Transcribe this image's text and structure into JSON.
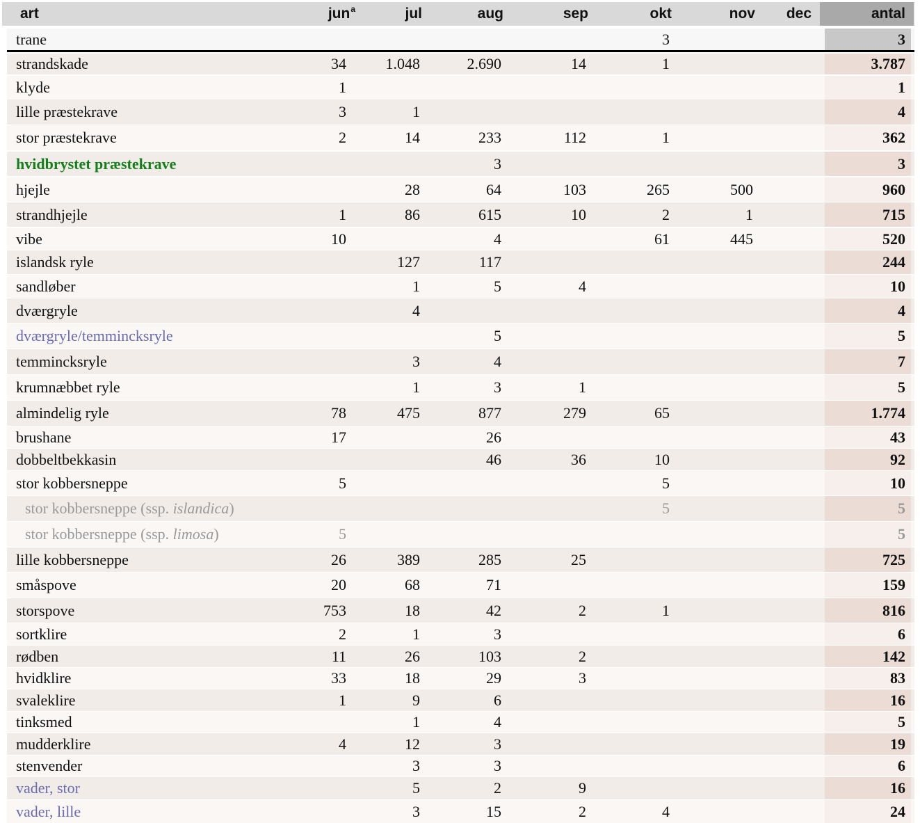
{
  "columns": [
    {
      "label": "art"
    },
    {
      "label": "jun",
      "sup": "a"
    },
    {
      "label": "jul"
    },
    {
      "label": "aug"
    },
    {
      "label": "sep"
    },
    {
      "label": "okt"
    },
    {
      "label": "nov"
    },
    {
      "label": "dec"
    },
    {
      "label": "antal"
    }
  ],
  "rows": [
    {
      "art": "trane",
      "cells": [
        "",
        "",
        "",
        "",
        "3",
        "",
        ""
      ],
      "total": "3",
      "style": "first"
    },
    {
      "art": "strandskade",
      "cells": [
        "34",
        "1.048",
        "2.690",
        "14",
        "1",
        "",
        ""
      ],
      "total": "3.787"
    },
    {
      "art": "klyde",
      "cells": [
        "1",
        "",
        "",
        "",
        "",
        "",
        ""
      ],
      "total": "1"
    },
    {
      "art": "lille præstekrave",
      "cells": [
        "3",
        "1",
        "",
        "",
        "",
        "",
        ""
      ],
      "total": "4"
    },
    {
      "art": "stor præstekrave",
      "cells": [
        "2",
        "14",
        "233",
        "112",
        "1",
        "",
        ""
      ],
      "total": "362"
    },
    {
      "art": "hvidbrystet præstekrave",
      "cells": [
        "",
        "",
        "3",
        "",
        "",
        "",
        ""
      ],
      "total": "3",
      "highlight": "green"
    },
    {
      "art": "hjejle",
      "cells": [
        "",
        "28",
        "64",
        "103",
        "265",
        "500",
        ""
      ],
      "total": "960"
    },
    {
      "art": "strandhjejle",
      "cells": [
        "1",
        "86",
        "615",
        "10",
        "2",
        "1",
        ""
      ],
      "total": "715"
    },
    {
      "art": "vibe",
      "cells": [
        "10",
        "",
        "4",
        "",
        "61",
        "445",
        ""
      ],
      "total": "520"
    },
    {
      "art": "islandsk ryle",
      "cells": [
        "",
        "127",
        "117",
        "",
        "",
        "",
        ""
      ],
      "total": "244"
    },
    {
      "art": "sandløber",
      "cells": [
        "",
        "1",
        "5",
        "4",
        "",
        "",
        ""
      ],
      "total": "10"
    },
    {
      "art": "dværgryle",
      "cells": [
        "",
        "4",
        "",
        "",
        "",
        "",
        ""
      ],
      "total": "4"
    },
    {
      "art": "dværgryle/temmincksryle",
      "cells": [
        "",
        "",
        "5",
        "",
        "",
        "",
        ""
      ],
      "total": "5",
      "highlight": "blue"
    },
    {
      "art": "temmincksryle",
      "cells": [
        "",
        "3",
        "4",
        "",
        "",
        "",
        ""
      ],
      "total": "7"
    },
    {
      "art": "krumnæbbet ryle",
      "cells": [
        "",
        "1",
        "3",
        "1",
        "",
        "",
        ""
      ],
      "total": "5"
    },
    {
      "art": "almindelig ryle",
      "cells": [
        "78",
        "475",
        "877",
        "279",
        "65",
        "",
        ""
      ],
      "total": "1.774"
    },
    {
      "art": "brushane",
      "cells": [
        "17",
        "",
        "26",
        "",
        "",
        "",
        ""
      ],
      "total": "43"
    },
    {
      "art": "dobbeltbekkasin",
      "cells": [
        "",
        "",
        "46",
        "36",
        "10",
        "",
        ""
      ],
      "total": "92"
    },
    {
      "art": "stor kobbersneppe",
      "cells": [
        "5",
        "",
        "",
        "",
        "5",
        "",
        ""
      ],
      "total": "10"
    },
    {
      "art": "stor kobbersneppe (ssp. ",
      "art_italic": "islandica",
      "art_suffix": ")",
      "cells": [
        "",
        "",
        "",
        "",
        "5",
        "",
        ""
      ],
      "total": "5",
      "sub": true
    },
    {
      "art": "stor kobbersneppe (ssp. ",
      "art_italic": "limosa",
      "art_suffix": ")",
      "cells": [
        "5",
        "",
        "",
        "",
        "",
        "",
        ""
      ],
      "total": "5",
      "sub": true
    },
    {
      "art": "lille kobbersneppe",
      "cells": [
        "26",
        "389",
        "285",
        "25",
        "",
        "",
        ""
      ],
      "total": "725"
    },
    {
      "art": "småspove",
      "cells": [
        "20",
        "68",
        "71",
        "",
        "",
        "",
        ""
      ],
      "total": "159"
    },
    {
      "art": "storspove",
      "cells": [
        "753",
        "18",
        "42",
        "2",
        "1",
        "",
        ""
      ],
      "total": "816"
    },
    {
      "art": "sortklire",
      "cells": [
        "2",
        "1",
        "3",
        "",
        "",
        "",
        ""
      ],
      "total": "6"
    },
    {
      "art": "rødben",
      "cells": [
        "11",
        "26",
        "103",
        "2",
        "",
        "",
        ""
      ],
      "total": "142"
    },
    {
      "art": "hvidklire",
      "cells": [
        "33",
        "18",
        "29",
        "3",
        "",
        "",
        ""
      ],
      "total": "83"
    },
    {
      "art": "svaleklire",
      "cells": [
        "1",
        "9",
        "6",
        "",
        "",
        "",
        ""
      ],
      "total": "16"
    },
    {
      "art": "tinksmed",
      "cells": [
        "",
        "1",
        "4",
        "",
        "",
        "",
        ""
      ],
      "total": "5"
    },
    {
      "art": "mudderklire",
      "cells": [
        "4",
        "12",
        "3",
        "",
        "",
        "",
        ""
      ],
      "total": "19"
    },
    {
      "art": "stenvender",
      "cells": [
        "",
        "3",
        "3",
        "",
        "",
        "",
        ""
      ],
      "total": "6"
    },
    {
      "art": "vader, stor",
      "cells": [
        "",
        "5",
        "2",
        "9",
        "",
        "",
        ""
      ],
      "total": "16",
      "highlight": "blue"
    },
    {
      "art": "vader, lille",
      "cells": [
        "",
        "3",
        "15",
        "2",
        "4",
        "",
        ""
      ],
      "total": "24",
      "highlight": "blue"
    }
  ],
  "colors": {
    "header_bg": "#d9d9d9",
    "header_total_bg": "#a9a9a9",
    "row_odd": "#f2ece9",
    "row_even": "#faf7f5",
    "highlight_green": "#15801b",
    "highlight_blue": "#6b6bb0",
    "subspecies_gray": "#999999"
  }
}
